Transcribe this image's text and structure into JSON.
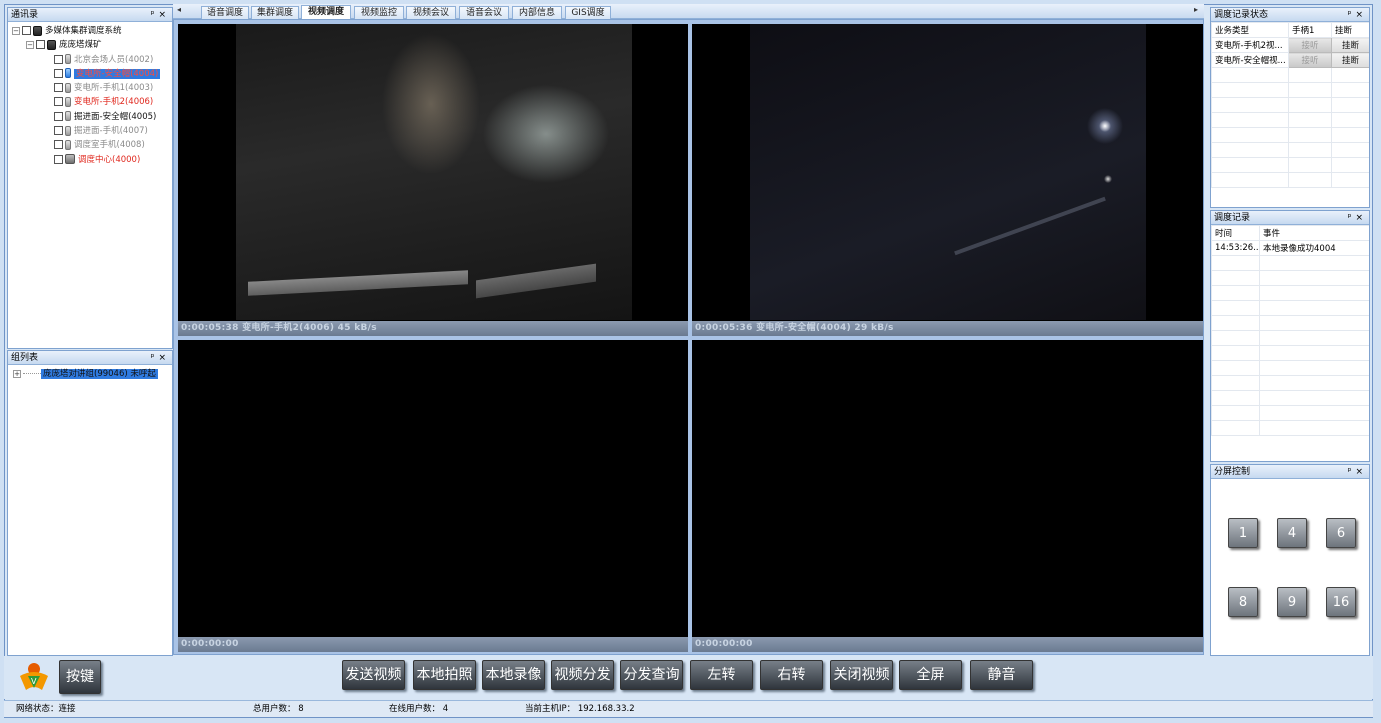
{
  "contacts_panel": {
    "title": "通讯录",
    "root": "多媒体集群调度系统",
    "group": "庞庞塔煤矿",
    "items": [
      {
        "label": "北京会场人员(4002)"
      },
      {
        "label": "变电所-安全帽(4004)"
      },
      {
        "label": "变电所-手机1(4003)"
      },
      {
        "label": "变电所-手机2(4006)"
      },
      {
        "label": "掘进面-安全帽(4005)"
      },
      {
        "label": "掘进面-手机(4007)"
      },
      {
        "label": "调度室手机(4008)"
      },
      {
        "label": "调度中心(4000)"
      }
    ]
  },
  "group_panel": {
    "title": "组列表",
    "item": "庞庞塔对讲组(99046) 未呼起"
  },
  "tabs": [
    "语音调度",
    "集群调度",
    "视频调度",
    "视频监控",
    "视频会议",
    "语音会议",
    "内部信息",
    "GIS调度"
  ],
  "videos": [
    {
      "status": "0:00:05:38  变电所-手机2(4006)  45 kB/s"
    },
    {
      "status": "0:00:05:36  变电所-安全帽(4004)  29 kB/s"
    },
    {
      "status": "0:00:00:00"
    },
    {
      "status": "0:00:00:00"
    }
  ],
  "dispatch_status": {
    "title": "调度记录状态",
    "headers": [
      "业务类型",
      "手柄1",
      "挂断"
    ],
    "rows": [
      {
        "type": "变电所-手机2视...",
        "action": "接听",
        "hangup": "挂断"
      },
      {
        "type": "变电所-安全帽视...",
        "action": "接听",
        "hangup": "挂断"
      }
    ]
  },
  "dispatch_log": {
    "title": "调度记录",
    "headers": [
      "时间",
      "事件"
    ],
    "rows": [
      {
        "time": "14:53:26...",
        "event": "本地录像成功4004"
      }
    ]
  },
  "split_control": {
    "title": "分屏控制",
    "buttons": [
      "1",
      "4",
      "6",
      "8",
      "9",
      "16"
    ]
  },
  "toolbar": {
    "hotkey": "按键",
    "buttons": [
      "发送视频",
      "本地拍照",
      "本地录像",
      "视频分发",
      "分发查询",
      "左转",
      "右转",
      "关闭视频",
      "全屏",
      "静音"
    ]
  },
  "statusbar": {
    "network": "网络状态：连接",
    "total_users": "总用户数：  8",
    "online_users": "在线用户数：  4",
    "host_ip": "当前主机IP：  192.168.33.2"
  },
  "panel_buttons": {
    "pin": "ᵖ",
    "close": "×"
  },
  "colors": {
    "accent": "#2f7be0",
    "alert_red": "#e0281e",
    "panel_border": "#7fa2cf"
  }
}
